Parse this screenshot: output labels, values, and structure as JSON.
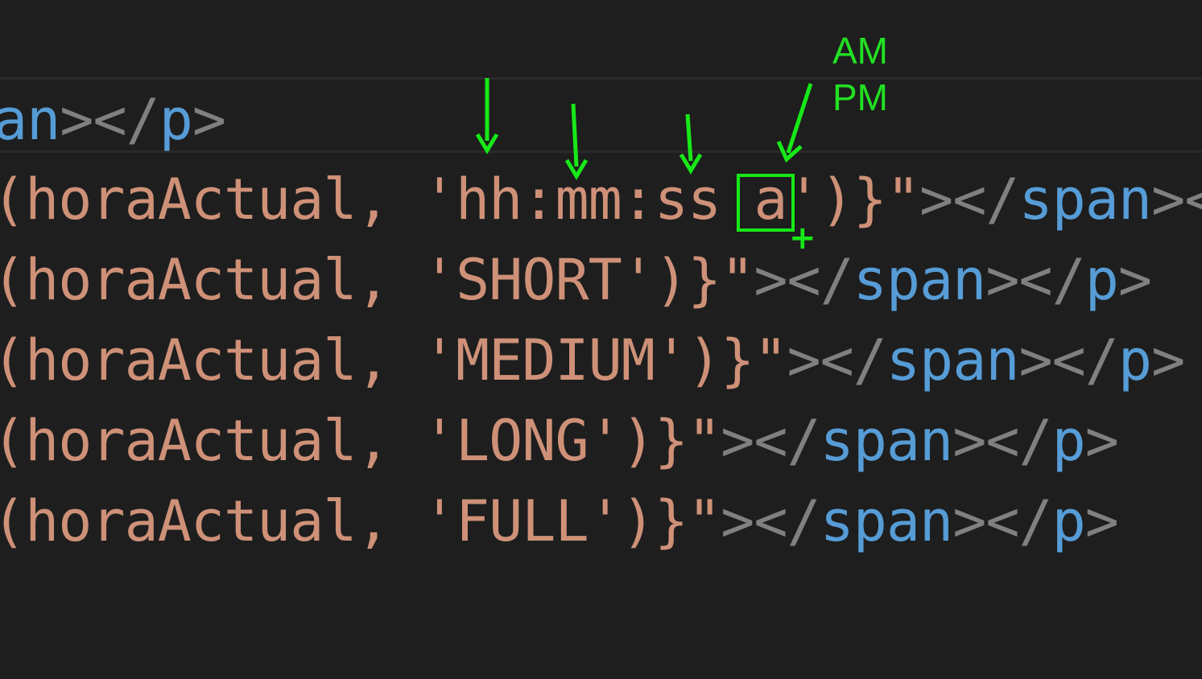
{
  "editor": {
    "lines": [
      {
        "tokens": [
          {
            "text": "an",
            "cls": "tok-tag"
          },
          {
            "text": "></",
            "cls": "tok-punct"
          },
          {
            "text": "p",
            "cls": "tok-tag"
          },
          {
            "text": ">",
            "cls": "tok-punct"
          }
        ]
      },
      {
        "tokens": [
          {
            "text": "(horaActual, ",
            "cls": "tok-fn"
          },
          {
            "text": "'hh:mm:ss ",
            "cls": "tok-str"
          },
          {
            "text": "a",
            "cls": "tok-str"
          },
          {
            "text": "')}\"",
            "cls": "tok-str"
          },
          {
            "text": "></",
            "cls": "tok-punct"
          },
          {
            "text": "span",
            "cls": "tok-tag"
          },
          {
            "text": "><",
            "cls": "tok-punct"
          }
        ]
      },
      {
        "tokens": [
          {
            "text": "(horaActual, ",
            "cls": "tok-fn"
          },
          {
            "text": "'SHORT')}\"",
            "cls": "tok-str"
          },
          {
            "text": "></",
            "cls": "tok-punct"
          },
          {
            "text": "span",
            "cls": "tok-tag"
          },
          {
            "text": "></",
            "cls": "tok-punct"
          },
          {
            "text": "p",
            "cls": "tok-tag"
          },
          {
            "text": ">",
            "cls": "tok-punct"
          }
        ]
      },
      {
        "tokens": [
          {
            "text": "(horaActual, ",
            "cls": "tok-fn"
          },
          {
            "text": "'MEDIUM')}\"",
            "cls": "tok-str"
          },
          {
            "text": "></",
            "cls": "tok-punct"
          },
          {
            "text": "span",
            "cls": "tok-tag"
          },
          {
            "text": "></",
            "cls": "tok-punct"
          },
          {
            "text": "p",
            "cls": "tok-tag"
          },
          {
            "text": ">",
            "cls": "tok-punct"
          }
        ]
      },
      {
        "tokens": [
          {
            "text": "(horaActual, ",
            "cls": "tok-fn"
          },
          {
            "text": "'LONG')}\"",
            "cls": "tok-str"
          },
          {
            "text": "></",
            "cls": "tok-punct"
          },
          {
            "text": "span",
            "cls": "tok-tag"
          },
          {
            "text": "></",
            "cls": "tok-punct"
          },
          {
            "text": "p",
            "cls": "tok-tag"
          },
          {
            "text": ">",
            "cls": "tok-punct"
          }
        ]
      },
      {
        "tokens": [
          {
            "text": "(horaActual, ",
            "cls": "tok-fn"
          },
          {
            "text": "'FULL')}\"",
            "cls": "tok-str"
          },
          {
            "text": "></",
            "cls": "tok-punct"
          },
          {
            "text": "span",
            "cls": "tok-tag"
          },
          {
            "text": "></",
            "cls": "tok-punct"
          },
          {
            "text": "p",
            "cls": "tok-tag"
          },
          {
            "text": ">",
            "cls": "tok-punct"
          }
        ]
      }
    ]
  },
  "annotations": {
    "ampm_label_line1": "AM",
    "ampm_label_line2": "PM",
    "arrow_targets": [
      "hh",
      "mm",
      "ss",
      "a"
    ],
    "highlighted_token": "a",
    "color": "#17e817"
  }
}
